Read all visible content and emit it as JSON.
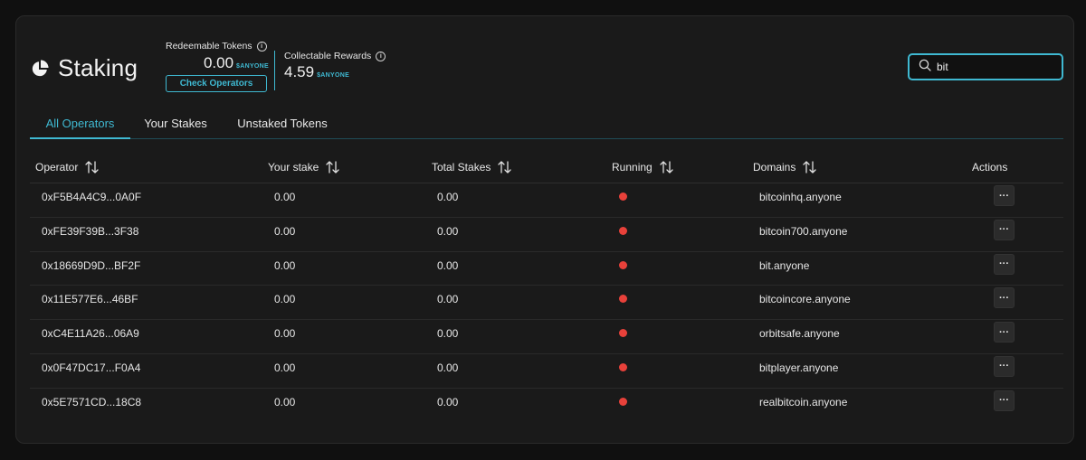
{
  "page": {
    "title": "Staking"
  },
  "stats": {
    "redeemable": {
      "label": "Redeemable Tokens",
      "value": "0.00",
      "unit": "$ANYONE",
      "button_label": "Check Operators"
    },
    "collectable": {
      "label": "Collectable Rewards",
      "value": "4.59",
      "unit": "$ANYONE"
    },
    "info_icon_glyph": "i"
  },
  "search": {
    "value": "bit",
    "icon": "search-icon"
  },
  "tabs": [
    {
      "label": "All Operators",
      "active": true
    },
    {
      "label": "Your Stakes",
      "active": false
    },
    {
      "label": "Unstaked Tokens",
      "active": false
    }
  ],
  "table": {
    "columns": [
      "Operator",
      "Your stake",
      "Total Stakes",
      "Running",
      "Domains",
      "Actions"
    ],
    "rows": [
      {
        "operator": "0xF5B4A4C9...0A0F",
        "your_stake": "0.00",
        "total_stakes": "0.00",
        "running": false,
        "domain": "bitcoinhq.anyone",
        "action": "···"
      },
      {
        "operator": "0xFE39F39B...3F38",
        "your_stake": "0.00",
        "total_stakes": "0.00",
        "running": false,
        "domain": "bitcoin700.anyone",
        "action": "···"
      },
      {
        "operator": "0x18669D9D...BF2F",
        "your_stake": "0.00",
        "total_stakes": "0.00",
        "running": false,
        "domain": "bit.anyone",
        "action": "···"
      },
      {
        "operator": "0x11E577E6...46BF",
        "your_stake": "0.00",
        "total_stakes": "0.00",
        "running": false,
        "domain": "bitcoincore.anyone",
        "action": "···"
      },
      {
        "operator": "0xC4E11A26...06A9",
        "your_stake": "0.00",
        "total_stakes": "0.00",
        "running": false,
        "domain": "orbitsafe.anyone",
        "action": "···"
      },
      {
        "operator": "0x0F47DC17...F0A4",
        "your_stake": "0.00",
        "total_stakes": "0.00",
        "running": false,
        "domain": "bitplayer.anyone",
        "action": "···"
      },
      {
        "operator": "0x5E7571CD...18C8",
        "your_stake": "0.00",
        "total_stakes": "0.00",
        "running": false,
        "domain": "realbitcoin.anyone",
        "action": "···"
      }
    ]
  },
  "colors": {
    "accent": "#3fb9d2",
    "status_stopped": "#e8413a",
    "background": "#101010",
    "card": "#1a1a1a"
  }
}
